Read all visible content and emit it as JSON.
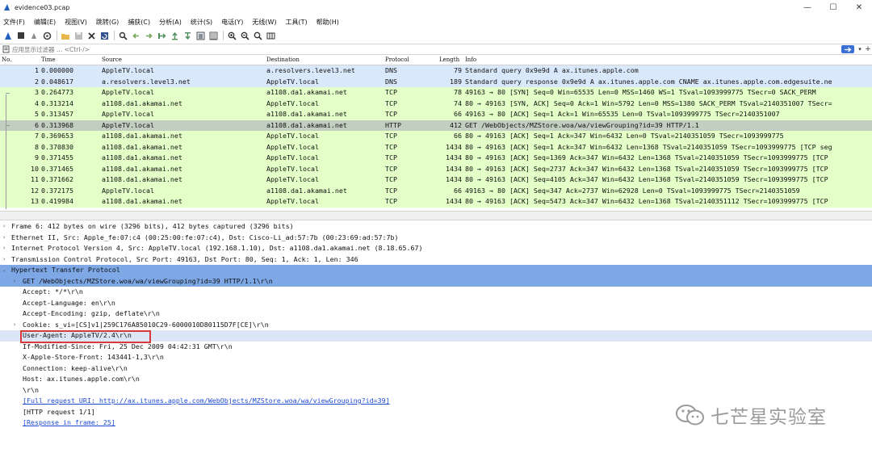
{
  "window": {
    "title": "evidence03.pcap",
    "buttons": {
      "minimize": "—",
      "maximize": "☐",
      "close": "✕"
    }
  },
  "menu": [
    "文件(F)",
    "编辑(E)",
    "视图(V)",
    "跳转(G)",
    "捕获(C)",
    "分析(A)",
    "统计(S)",
    "电话(Y)",
    "无线(W)",
    "工具(T)",
    "帮助(H)"
  ],
  "filter": {
    "placeholder": "应用显示过滤器 … <Ctrl-/>"
  },
  "packet_list": {
    "columns": [
      "No.",
      "Time",
      "Source",
      "Destination",
      "Protocol",
      "Length",
      "Info"
    ],
    "rows": [
      {
        "no": "1",
        "time": "0.000000",
        "src": "AppleTV.local",
        "dst": "a.resolvers.level3.net",
        "proto": "DNS",
        "len": "79",
        "info": "Standard query 0x9e9d A ax.itunes.apple.com",
        "kind": "dns"
      },
      {
        "no": "2",
        "time": "0.048617",
        "src": "a.resolvers.level3.net",
        "dst": "AppleTV.local",
        "proto": "DNS",
        "len": "189",
        "info": "Standard query response 0x9e9d A ax.itunes.apple.com CNAME ax.itunes.apple.com.edgesuite.ne",
        "kind": "dns"
      },
      {
        "no": "3",
        "time": "0.264773",
        "src": "AppleTV.local",
        "dst": "a1108.da1.akamai.net",
        "proto": "TCP",
        "len": "78",
        "info": "49163 → 80 [SYN] Seq=0 Win=65535 Len=0 MSS=1460 WS=1 TSval=1093999775 TSecr=0 SACK_PERM",
        "kind": "tcp"
      },
      {
        "no": "4",
        "time": "0.313214",
        "src": "a1108.da1.akamai.net",
        "dst": "AppleTV.local",
        "proto": "TCP",
        "len": "74",
        "info": "80 → 49163 [SYN, ACK] Seq=0 Ack=1 Win=5792 Len=0 MSS=1380 SACK_PERM TSval=2140351007 TSecr=",
        "kind": "tcp"
      },
      {
        "no": "5",
        "time": "0.313457",
        "src": "AppleTV.local",
        "dst": "a1108.da1.akamai.net",
        "proto": "TCP",
        "len": "66",
        "info": "49163 → 80 [ACK] Seq=1 Ack=1 Win=65535 Len=0 TSval=1093999775 TSecr=2140351007",
        "kind": "tcp"
      },
      {
        "no": "6",
        "time": "0.313968",
        "src": "AppleTV.local",
        "dst": "a1108.da1.akamai.net",
        "proto": "HTTP",
        "len": "412",
        "info": "GET /WebObjects/MZStore.woa/wa/viewGrouping?id=39 HTTP/1.1",
        "kind": "selected"
      },
      {
        "no": "7",
        "time": "0.369653",
        "src": "a1108.da1.akamai.net",
        "dst": "AppleTV.local",
        "proto": "TCP",
        "len": "66",
        "info": "80 → 49163 [ACK] Seq=1 Ack=347 Win=6432 Len=0 TSval=2140351059 TSecr=1093999775",
        "kind": "tcp"
      },
      {
        "no": "8",
        "time": "0.370830",
        "src": "a1108.da1.akamai.net",
        "dst": "AppleTV.local",
        "proto": "TCP",
        "len": "1434",
        "info": "80 → 49163 [ACK] Seq=1 Ack=347 Win=6432 Len=1368 TSval=2140351059 TSecr=1093999775 [TCP seg",
        "kind": "tcp"
      },
      {
        "no": "9",
        "time": "0.371455",
        "src": "a1108.da1.akamai.net",
        "dst": "AppleTV.local",
        "proto": "TCP",
        "len": "1434",
        "info": "80 → 49163 [ACK] Seq=1369 Ack=347 Win=6432 Len=1368 TSval=2140351059 TSecr=1093999775 [TCP",
        "kind": "tcp"
      },
      {
        "no": "10",
        "time": "0.371465",
        "src": "a1108.da1.akamai.net",
        "dst": "AppleTV.local",
        "proto": "TCP",
        "len": "1434",
        "info": "80 → 49163 [ACK] Seq=2737 Ack=347 Win=6432 Len=1368 TSval=2140351059 TSecr=1093999775 [TCP",
        "kind": "tcp"
      },
      {
        "no": "11",
        "time": "0.371662",
        "src": "a1108.da1.akamai.net",
        "dst": "AppleTV.local",
        "proto": "TCP",
        "len": "1434",
        "info": "80 → 49163 [ACK] Seq=4105 Ack=347 Win=6432 Len=1368 TSval=2140351059 TSecr=1093999775 [TCP",
        "kind": "tcp"
      },
      {
        "no": "12",
        "time": "0.372175",
        "src": "AppleTV.local",
        "dst": "a1108.da1.akamai.net",
        "proto": "TCP",
        "len": "66",
        "info": "49163 → 80 [ACK] Seq=347 Ack=2737 Win=62928 Len=0 TSval=1093999775 TSecr=2140351059",
        "kind": "tcp"
      },
      {
        "no": "13",
        "time": "0.419984",
        "src": "a1108.da1.akamai.net",
        "dst": "AppleTV.local",
        "proto": "TCP",
        "len": "1434",
        "info": "80 → 49163 [ACK] Seq=5473 Ack=347 Win=6432 Len=1368 TSval=2140351112 TSecr=1093999775 [TCP",
        "kind": "tcp"
      }
    ]
  },
  "details": [
    {
      "text": "Frame 6: 412 bytes on wire (3296 bits), 412 bytes captured (3296 bits)",
      "level": 0,
      "arrow": "›",
      "hl": ""
    },
    {
      "text": "Ethernet II, Src: Apple_fe:07:c4 (00:25:00:fe:07:c4), Dst: Cisco-Li_ad:57:7b (00:23:69:ad:57:7b)",
      "level": 0,
      "arrow": "›",
      "hl": ""
    },
    {
      "text": "Internet Protocol Version 4, Src: AppleTV.local (192.168.1.10), Dst: a1108.da1.akamai.net (8.18.65.67)",
      "level": 0,
      "arrow": "›",
      "hl": ""
    },
    {
      "text": "Transmission Control Protocol, Src Port: 49163, Dst Port: 80, Seq: 1, Ack: 1, Len: 346",
      "level": 0,
      "arrow": "›",
      "hl": ""
    },
    {
      "text": "Hypertext Transfer Protocol",
      "level": 0,
      "arrow": "⌄",
      "hl": "hl-dark"
    },
    {
      "text": "GET /WebObjects/MZStore.woa/wa/viewGrouping?id=39 HTTP/1.1\\r\\n",
      "level": 1,
      "arrow": "›",
      "hl": "hl-dark"
    },
    {
      "text": "Accept: */*\\r\\n",
      "level": 1,
      "arrow": "",
      "hl": ""
    },
    {
      "text": "Accept-Language: en\\r\\n",
      "level": 1,
      "arrow": "",
      "hl": ""
    },
    {
      "text": "Accept-Encoding: gzip, deflate\\r\\n",
      "level": 1,
      "arrow": "",
      "hl": ""
    },
    {
      "text": "Cookie: s_vi=[CS]v1|259C176A85010C29-6000010D80115D7F[CE]\\r\\n",
      "level": 1,
      "arrow": "›",
      "hl": ""
    },
    {
      "text": "User-Agent: AppleTV/2.4\\r\\n",
      "level": 1,
      "arrow": "",
      "hl": "hl-light"
    },
    {
      "text": "If-Modified-Since: Fri, 25 Dec 2009 04:42:31 GMT\\r\\n",
      "level": 1,
      "arrow": "",
      "hl": ""
    },
    {
      "text": "X-Apple-Store-Front: 143441-1,3\\r\\n",
      "level": 1,
      "arrow": "",
      "hl": ""
    },
    {
      "text": "Connection: keep-alive\\r\\n",
      "level": 1,
      "arrow": "",
      "hl": ""
    },
    {
      "text": "Host: ax.itunes.apple.com\\r\\n",
      "level": 1,
      "arrow": "",
      "hl": ""
    },
    {
      "text": "\\r\\n",
      "level": 1,
      "arrow": "",
      "hl": ""
    },
    {
      "text": "[Full request URI: http://ax.itunes.apple.com/WebObjects/MZStore.woa/wa/viewGrouping?id=39]",
      "level": 1,
      "arrow": "",
      "hl": "",
      "link": true
    },
    {
      "text": "[HTTP request 1/1]",
      "level": 1,
      "arrow": "",
      "hl": ""
    },
    {
      "text": "[Response in frame: 25]",
      "level": 1,
      "arrow": "",
      "hl": "",
      "link": true
    }
  ],
  "watermark": {
    "text": "七芒星实验室"
  },
  "colors": {
    "dns_row": "#dae8fc",
    "tcp_row": "#e4ffc7",
    "selected_row": "#c2cfc0",
    "tree_highlight": "#7ea7e6",
    "annotation_box": "#d63a3a"
  },
  "icons": {
    "toolbar": [
      "shark-fin-start-icon",
      "stop-icon",
      "restart-icon",
      "options-gear-icon",
      "open-folder-icon",
      "save-file-icon",
      "close-file-icon",
      "reload-icon",
      "find-icon",
      "go-back-icon",
      "go-forward-icon",
      "go-to-packet-icon",
      "go-first-icon",
      "go-last-icon",
      "autoscroll-icon",
      "colorize-icon",
      "zoom-in-icon",
      "zoom-out-icon",
      "zoom-normal-icon",
      "resize-columns-icon"
    ]
  }
}
